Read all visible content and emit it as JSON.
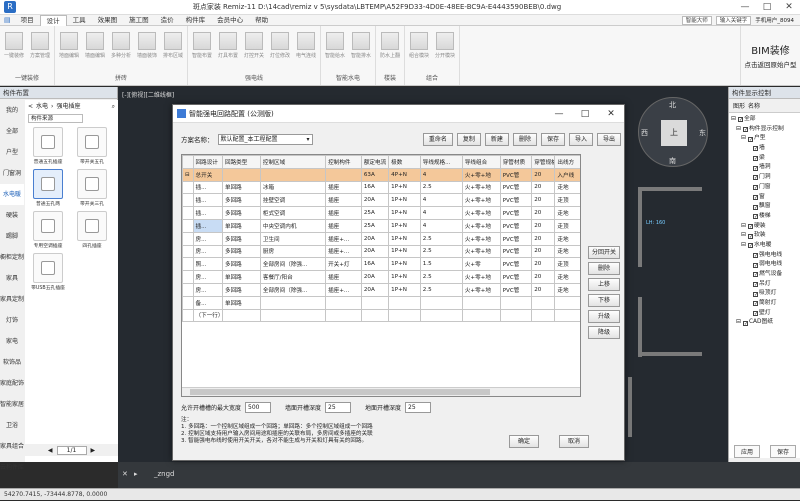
{
  "window": {
    "title": "斑点家装 Remiz-11    D:\\14cad\\remiz v 5\\sysdata\\LBTEMP\\A52F9D33-4D0E-48EE-BC9A-E4443590BEB\\0.dwg",
    "min": "—",
    "max": "□",
    "close": "✕"
  },
  "menu": {
    "items": [
      "项目",
      "设计",
      "工具",
      "效果图",
      "施工图",
      "造价",
      "构件库",
      "会员中心",
      "帮助"
    ],
    "active": 1,
    "right_box1": "智能大师",
    "right_box2": "输入关键字",
    "right_user": "手机用户_8094"
  },
  "ribbon": {
    "groups": [
      {
        "label": "一键装修",
        "buttons": [
          "一键装修",
          "方案管理"
        ]
      },
      {
        "label": "拼砖",
        "buttons": [
          "地面编辑",
          "墙面编辑",
          "多种分析",
          "墙面装饰",
          "排布区域"
        ]
      },
      {
        "label": "强电线",
        "buttons": [
          "智能布置",
          "灯具布置",
          "灯控开关",
          "灯位修改",
          "电气连线"
        ]
      },
      {
        "label": "智能水电",
        "buttons": [
          "智能给水",
          "智能排水"
        ]
      },
      {
        "label": "楼装",
        "buttons": [
          "防水上翻"
        ]
      },
      {
        "label": "组合",
        "buttons": [
          "组合模块",
          "分开模块"
        ]
      }
    ],
    "bim_title": "BIM装修",
    "bim_sub": "点击返回原始户型"
  },
  "left": {
    "title": "构件布置",
    "categories": [
      "我的",
      "全部",
      "户型",
      "门窗洞",
      "水电暖",
      "硬装",
      "踢脚",
      "橱柜定制",
      "家具",
      "家具定制",
      "灯饰",
      "家电",
      "软饰品",
      "家庭配饰",
      "智能家居",
      "卫浴",
      "家具组合",
      "云构件库"
    ],
    "active_category": 4,
    "path_back": "水电",
    "path_current": "强电插座",
    "dropdown": "构件来源",
    "tiles": [
      "普通五孔插座",
      "带开关五孔",
      "普通五孔两",
      "带开关三孔",
      "专用空调插座",
      "四孔插座",
      "带USB五孔插座"
    ],
    "selected_tile": 2,
    "pager": "1/1"
  },
  "canvas": {
    "view_label": "[-][俯视][二维线框]",
    "dims": [
      "LH: 960",
      "LH: 960",
      "LH: 960",
      "LH: 160",
      "LH: 960"
    ],
    "compass": {
      "n": "北",
      "s": "南",
      "w": "西",
      "e": "东",
      "center": "上"
    }
  },
  "right": {
    "title": "构件显示控制",
    "tabs": [
      "图形",
      "名称"
    ],
    "tree": [
      "全部",
      "构件显示控制",
      "户型",
      "墙",
      "梁",
      "墙洞",
      "门洞",
      "门窗",
      "窗",
      "飘窗",
      "楼梯",
      "硬装",
      "软装",
      "水电暖",
      "强电电线",
      "弱电电线",
      "燃气设备",
      "吊灯",
      "吸顶灯",
      "筒射灯",
      "壁灯",
      "CAD图纸"
    ],
    "apply": "应用",
    "save": "保存"
  },
  "cmd": {
    "prompt": "_zngd"
  },
  "status": {
    "coords": "54270.7415, -73444.8778, 0.0000"
  },
  "dialog": {
    "title": "智能强电回路配置 (公测版)",
    "scheme_label": "方案名称：",
    "scheme_value": "默认配置_本工程配置",
    "top_buttons": [
      "重命名",
      "复制",
      "新建",
      "删除",
      "保存",
      "导入",
      "导出"
    ],
    "columns": [
      "回路设计",
      "回路类型",
      "控制区域",
      "控制构件",
      "额定电流",
      "极数",
      "导线规格...",
      "导线组合",
      "穿管材质",
      "穿管规格",
      "出线方"
    ],
    "rows": [
      [
        "总开关",
        "",
        "",
        "",
        "63A",
        "4P+N",
        "4",
        "火+零+地",
        "PVC管",
        "20",
        "入户线"
      ],
      [
        "插...",
        "单回路",
        "冰箱",
        "插座",
        "16A",
        "1P+N",
        "2.5",
        "火+零+地",
        "PVC管",
        "20",
        "走地"
      ],
      [
        "插...",
        "多回路",
        "挂壁空调",
        "插座",
        "20A",
        "1P+N",
        "4",
        "火+零+地",
        "PVC管",
        "20",
        "走顶"
      ],
      [
        "插...",
        "多回路",
        "柜式空调",
        "插座",
        "25A",
        "1P+N",
        "4",
        "火+零+地",
        "PVC管",
        "20",
        "走地"
      ],
      [
        "插...",
        "单回路",
        "中央空调内机",
        "插座",
        "25A",
        "1P+N",
        "4",
        "火+零+地",
        "PVC管",
        "20",
        "走顶"
      ],
      [
        "房...",
        "多回路",
        "卫生间",
        "插座+...",
        "20A",
        "1P+N",
        "2.5",
        "火+零+地",
        "PVC管",
        "20",
        "走地"
      ],
      [
        "房...",
        "多回路",
        "厨房",
        "插座+...",
        "20A",
        "1P+N",
        "2.5",
        "火+零+地",
        "PVC管",
        "20",
        "走地"
      ],
      [
        "照...",
        "多回路",
        "全部房间（除强...",
        "开关+灯",
        "16A",
        "1P+N",
        "1.5",
        "火+零",
        "PVC管",
        "20",
        "走顶"
      ],
      [
        "房...",
        "单回路",
        "客餐厅/阳台",
        "插座",
        "20A",
        "1P+N",
        "2.5",
        "火+零+地",
        "PVC管",
        "20",
        "走地"
      ],
      [
        "房...",
        "多回路",
        "全部房间（除强...",
        "插座+...",
        "20A",
        "1P+N",
        "2.5",
        "火+零+地",
        "PVC管",
        "20",
        "走地"
      ],
      [
        "备...",
        "单回路",
        "",
        "",
        "",
        "",
        "",
        "",
        "",
        "",
        ""
      ],
      [
        "（下一行）",
        "",
        "",
        "",
        "",
        "",
        "",
        "",
        "",
        "",
        ""
      ]
    ],
    "side_buttons": [
      "分回开关",
      "删除",
      "上移",
      "下移",
      "升级",
      "降级"
    ],
    "bottom": {
      "l1": "允许开槽槽的最大宽度",
      "v1": "500",
      "l2": "墙面开槽深度",
      "v2": "25",
      "l3": "地面开槽深度",
      "v3": "25"
    },
    "notes": [
      "注：",
      "1. 多回路：一个控制区域组成一个回路；单回路：多个控制区域组成一个回路",
      "2. 控制区域支持用户输入房间用途和插座的关联布局，多房间或多插座的关联",
      "3. 智能强电布线时使用开关开关，各对不能生成与开关和灯具有关的回路。"
    ],
    "ok": "确定",
    "cancel": "取消"
  }
}
